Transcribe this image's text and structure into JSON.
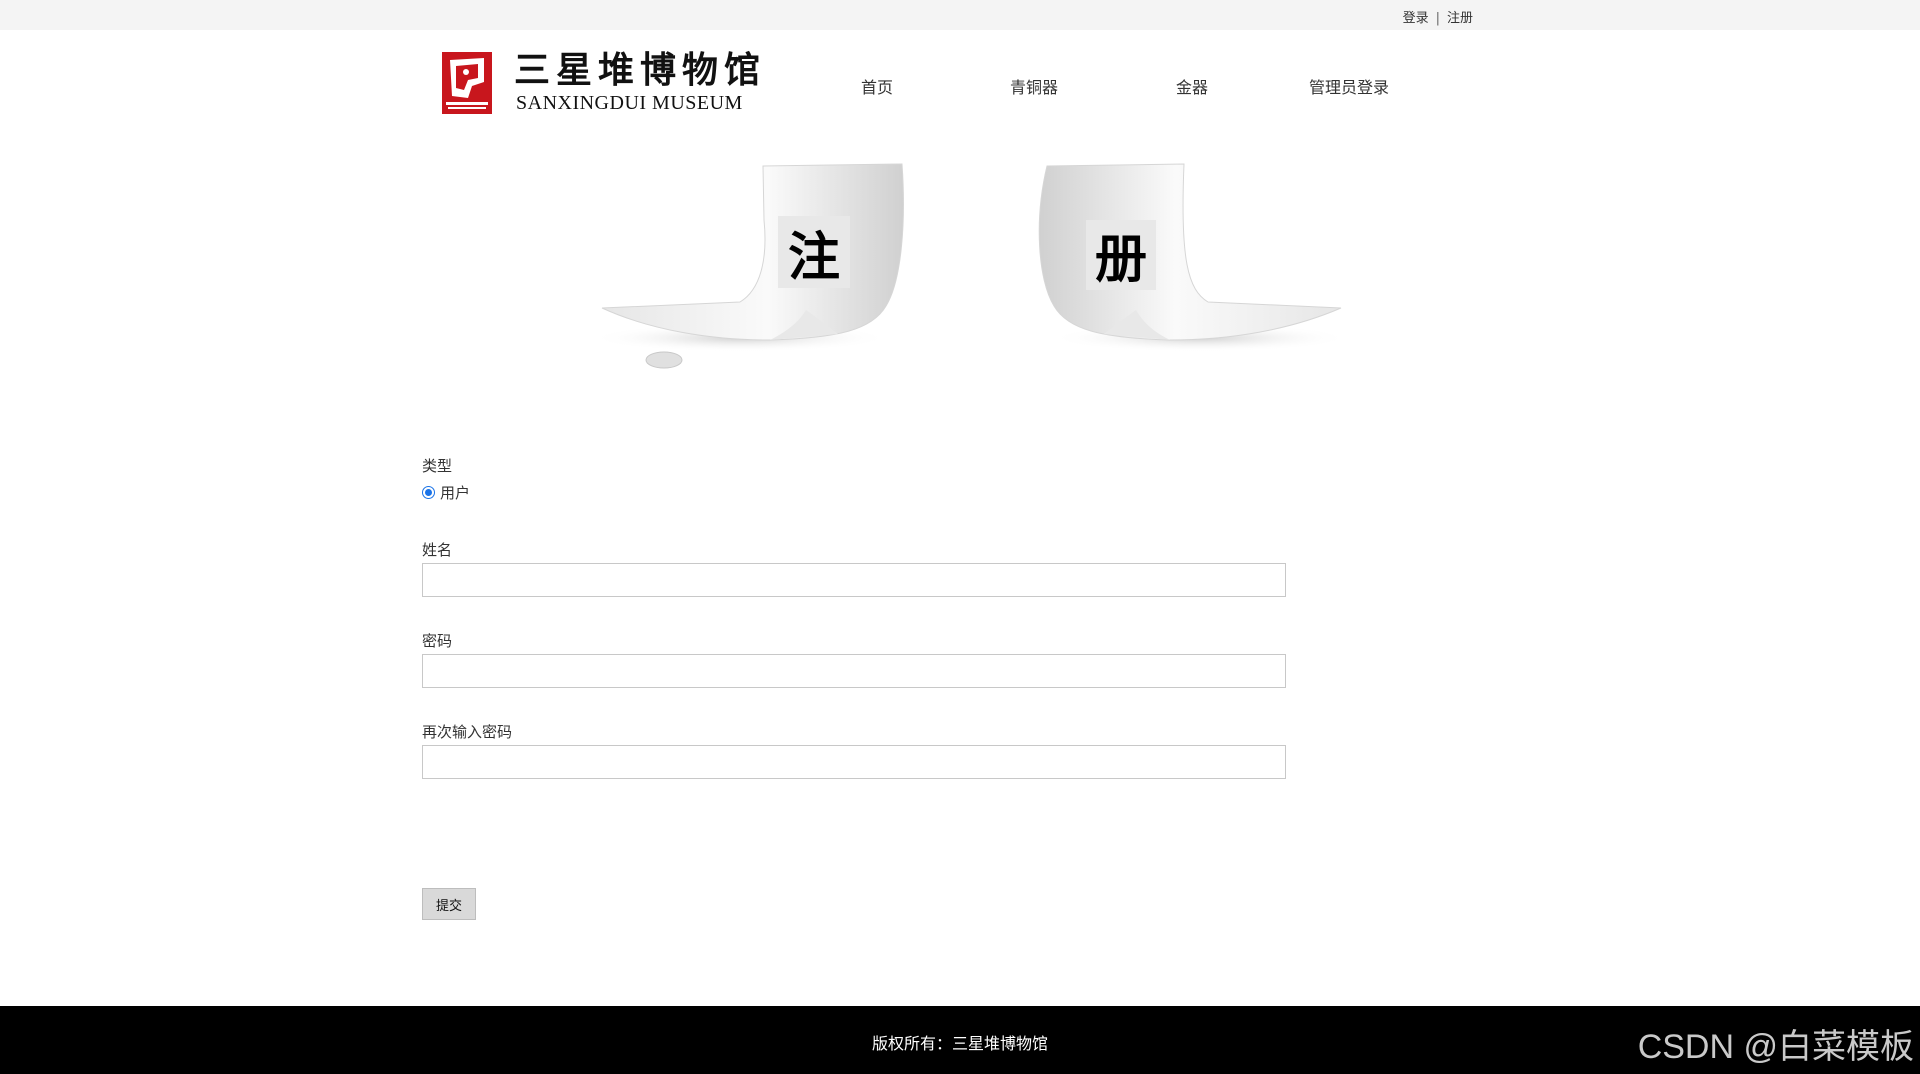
{
  "topbar": {
    "login": "登录",
    "separator": "|",
    "register": "注册"
  },
  "logo": {
    "cn": "三星堆博物馆",
    "en": "SANXINGDUI MUSEUM",
    "mark_text": "SANXINGDUI MUSEUM"
  },
  "nav": {
    "items": [
      {
        "label": "首页"
      },
      {
        "label": "青铜器"
      },
      {
        "label": "金器"
      },
      {
        "label": "管理员登录"
      }
    ]
  },
  "banner": {
    "left_char": "注",
    "right_char": "册"
  },
  "form": {
    "type_label": "类型",
    "type_option": "用户",
    "name_label": "姓名",
    "name_value": "",
    "password_label": "密码",
    "password_value": "",
    "confirm_label": "再次输入密码",
    "confirm_value": "",
    "submit_label": "提交"
  },
  "footer": {
    "copyright": "版权所有：三星堆博物馆",
    "watermark": "CSDN @白菜模板"
  },
  "colors": {
    "logo_red": "#c8161d",
    "radio_blue": "#1a73e8",
    "footer_bg": "#000000"
  }
}
